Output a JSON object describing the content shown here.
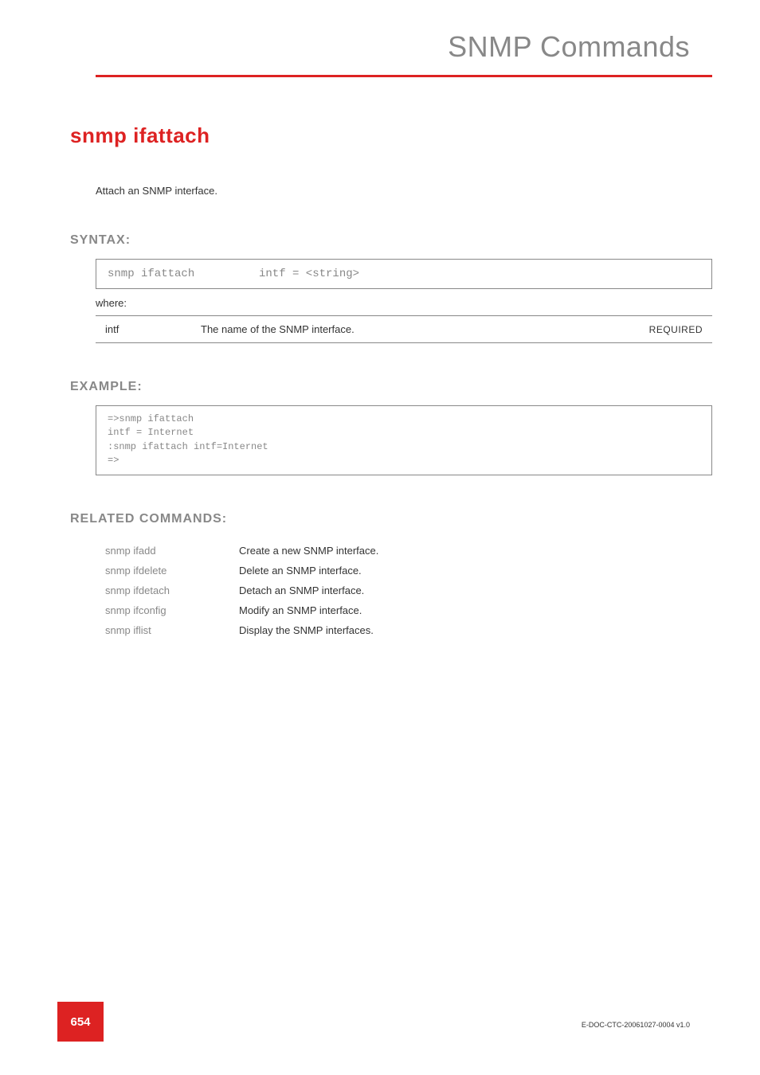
{
  "header": {
    "title": "SNMP Commands"
  },
  "command": {
    "title": "snmp ifattach",
    "description": "Attach an SNMP interface."
  },
  "syntax": {
    "heading": "SYNTAX:",
    "command": "snmp ifattach",
    "args": "intf = <string>",
    "where": "where:",
    "params": [
      {
        "name": "intf",
        "desc": "The name of the SNMP interface.",
        "req": "REQUIRED"
      }
    ]
  },
  "example": {
    "heading": "EXAMPLE:",
    "content": "=>snmp ifattach\nintf = Internet\n:snmp ifattach intf=Internet\n=>"
  },
  "related": {
    "heading": "RELATED COMMANDS:",
    "items": [
      {
        "cmd": "snmp ifadd",
        "desc": "Create a new SNMP interface."
      },
      {
        "cmd": "snmp ifdelete",
        "desc": "Delete an SNMP interface."
      },
      {
        "cmd": "snmp ifdetach",
        "desc": "Detach an SNMP interface."
      },
      {
        "cmd": "snmp ifconfig",
        "desc": "Modify an SNMP interface."
      },
      {
        "cmd": "snmp iflist",
        "desc": "Display the SNMP interfaces."
      }
    ]
  },
  "footer": {
    "page": "654",
    "docid": "E-DOC-CTC-20061027-0004 v1.0"
  }
}
